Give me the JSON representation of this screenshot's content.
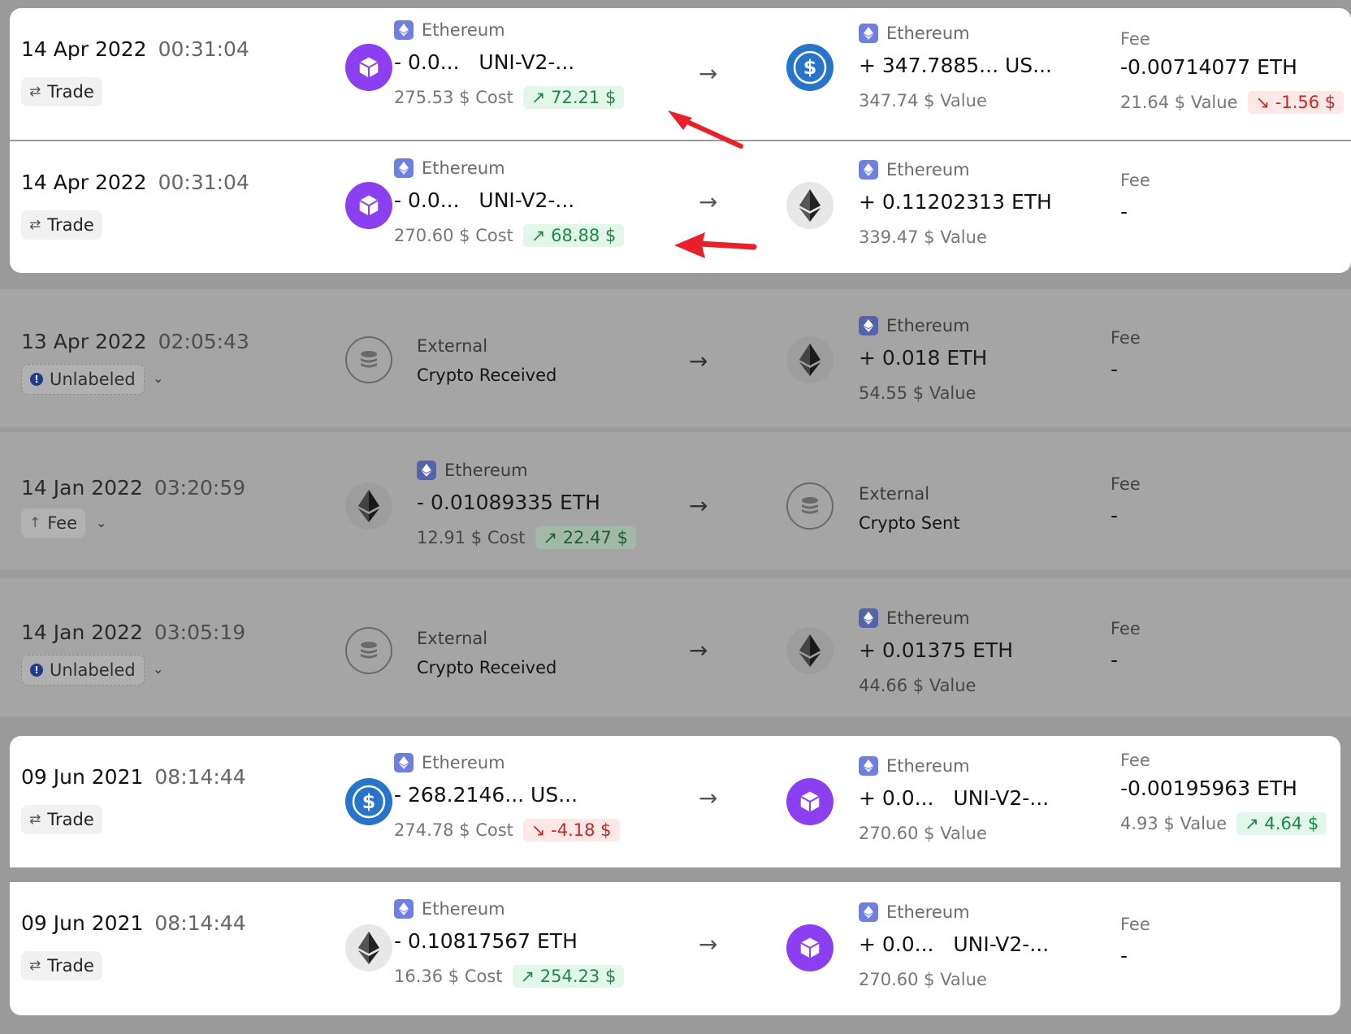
{
  "network_label": "Ethereum",
  "fee_label": "Fee",
  "arrow_glyph": "→",
  "rows": [
    {
      "date": "14 Apr 2022",
      "time": "00:31:04",
      "tag": "Trade",
      "sent": {
        "coin": "box-icon",
        "network": "Ethereum",
        "amount": "- 0.0...",
        "token": "UNI-V2-...",
        "usd": "275.53 $ Cost",
        "pnl": "↗ 72.21 $",
        "pnl_dir": "up"
      },
      "received": {
        "coin": "usdc-icon",
        "network": "Ethereum",
        "amount": "+ 347.7885... US...",
        "usd": "347.74 $ Value"
      },
      "fee": {
        "amount": "-0.00714077 ETH",
        "usd": "21.64 $ Value",
        "pnl": "↘ -1.56 $",
        "pnl_dir": "down"
      }
    },
    {
      "date": "14 Apr 2022",
      "time": "00:31:04",
      "tag": "Trade",
      "sent": {
        "coin": "box-icon",
        "network": "Ethereum",
        "amount": "- 0.0...",
        "token": "UNI-V2-...",
        "usd": "270.60 $ Cost",
        "pnl": "↗ 68.88 $",
        "pnl_dir": "up"
      },
      "received": {
        "coin": "eth-icon",
        "network": "Ethereum",
        "amount": "+ 0.11202313 ETH",
        "usd": "339.47 $ Value"
      },
      "fee": {
        "dash": "-"
      }
    },
    {
      "date": "13 Apr 2022",
      "time": "02:05:43",
      "tag": "Unlabeled",
      "sent": {
        "external1": "External",
        "external2": "Crypto Received"
      },
      "received": {
        "coin": "eth-icon",
        "network": "Ethereum",
        "amount": "+ 0.018 ETH",
        "usd": "54.55 $ Value"
      },
      "fee": {
        "dash": "-"
      }
    },
    {
      "date": "14 Jan 2022",
      "time": "03:20:59",
      "tag": "Fee",
      "sent": {
        "coin": "eth-icon",
        "network": "Ethereum",
        "amount": "- 0.01089335 ETH",
        "usd": "12.91 $ Cost",
        "pnl": "↗ 22.47 $",
        "pnl_dir": "up"
      },
      "received": {
        "external1": "External",
        "external2": "Crypto Sent"
      },
      "fee": {
        "dash": "-"
      }
    },
    {
      "date": "14 Jan 2022",
      "time": "03:05:19",
      "tag": "Unlabeled",
      "sent": {
        "external1": "External",
        "external2": "Crypto Received"
      },
      "received": {
        "coin": "eth-icon",
        "network": "Ethereum",
        "amount": "+ 0.01375 ETH",
        "usd": "44.66 $ Value"
      },
      "fee": {
        "dash": "-"
      }
    },
    {
      "date": "09 Jun 2021",
      "time": "08:14:44",
      "tag": "Trade",
      "sent": {
        "coin": "usdc-icon",
        "network": "Ethereum",
        "amount": "- 268.2146... US...",
        "usd": "274.78 $ Cost",
        "pnl": "↘ -4.18 $",
        "pnl_dir": "down"
      },
      "received": {
        "coin": "box-icon",
        "network": "Ethereum",
        "amount": "+ 0.0...",
        "token": "UNI-V2-...",
        "usd": "270.60 $ Value"
      },
      "fee": {
        "amount": "-0.00195963 ETH",
        "usd": "4.93 $ Value",
        "pnl": "↗ 4.64 $",
        "pnl_dir": "up"
      }
    },
    {
      "date": "09 Jun 2021",
      "time": "08:14:44",
      "tag": "Trade",
      "sent": {
        "coin": "eth-icon",
        "network": "Ethereum",
        "amount": "- 0.10817567 ETH",
        "usd": "16.36 $ Cost",
        "pnl": "↗ 254.23 $",
        "pnl_dir": "up"
      },
      "received": {
        "coin": "box-icon",
        "network": "Ethereum",
        "amount": "+ 0.0...",
        "token": "UNI-V2-...",
        "usd": "270.60 $ Value"
      },
      "fee": {
        "dash": "-"
      }
    }
  ]
}
